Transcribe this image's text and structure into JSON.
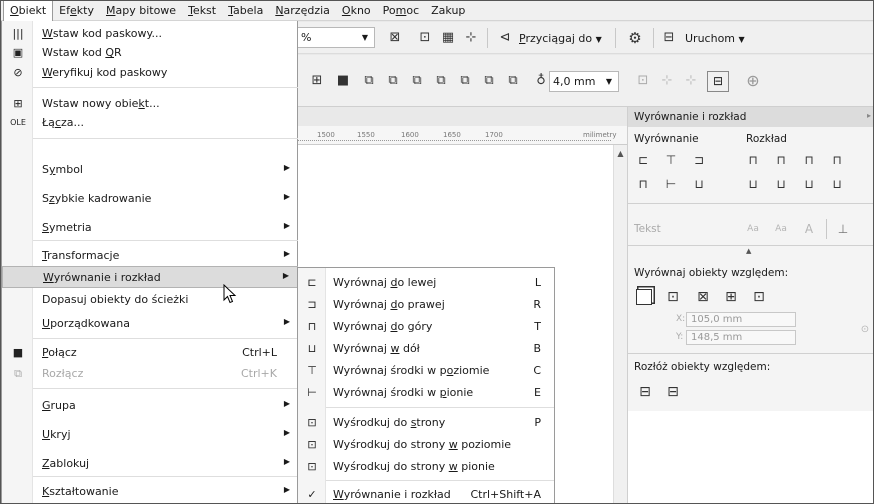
{
  "menubar": {
    "items": [
      {
        "pre": "",
        "u": "O",
        "post": "biekt"
      },
      {
        "pre": "Ef",
        "u": "e",
        "post": "kty"
      },
      {
        "pre": "",
        "u": "M",
        "post": "apy bitowe"
      },
      {
        "pre": "",
        "u": "T",
        "post": "ekst"
      },
      {
        "pre": "",
        "u": "T",
        "post": "abela"
      },
      {
        "pre": "",
        "u": "N",
        "post": "arzędzia"
      },
      {
        "pre": "",
        "u": "O",
        "post": "kno"
      },
      {
        "pre": "Po",
        "u": "m",
        "post": "oc"
      },
      {
        "pre": "Zakup",
        "u": "",
        "post": ""
      }
    ]
  },
  "toolbar": {
    "zoom_value": "%",
    "snap_pre": "",
    "snap_u": "P",
    "snap_post": "rzyciągaj do",
    "launch_label": "Uruchom",
    "outline_value": "4,0 mm"
  },
  "ruler": {
    "ticks": [
      "1500",
      "1550",
      "1600",
      "1650",
      "1700"
    ],
    "unit": "milimetry"
  },
  "docker": {
    "title": "Wyrównanie i rozkład",
    "align_tab": "Wyrównanie",
    "distribute_tab": "Rozkład",
    "text_label": "Tekst",
    "align_relative_label": "Wyrównaj obiekty względem:",
    "x_value": "105,0 mm",
    "y_value": "148,5 mm",
    "x_label": "X:",
    "y_label": "Y:",
    "distribute_relative_label": "Rozłóż obiekty względem:"
  },
  "menu": {
    "items": [
      {
        "icon": "barcode-icon",
        "pre": "",
        "u": "W",
        "post": "staw kod paskowy...",
        "shortcut": "",
        "arrow": false,
        "disabled": false
      },
      {
        "icon": "qr-code-icon",
        "pre": "Wstaw kod ",
        "u": "Q",
        "post": "R",
        "shortcut": "",
        "arrow": false,
        "disabled": false
      },
      {
        "icon": "verify-barcode-icon",
        "pre": "",
        "u": "W",
        "post": "eryfikuj kod paskowy",
        "shortcut": "",
        "arrow": false,
        "disabled": false
      },
      {
        "icon": "insert-object-icon",
        "pre": "Wstaw nowy obie",
        "u": "k",
        "post": "t...",
        "shortcut": "",
        "arrow": false,
        "disabled": false
      },
      {
        "icon": "ole-links-icon",
        "pre": "Łą",
        "u": "c",
        "post": "za...",
        "shortcut": "",
        "arrow": false,
        "disabled": false
      },
      {
        "icon": "",
        "pre": "S",
        "u": "y",
        "post": "mbol",
        "shortcut": "",
        "arrow": true,
        "disabled": false
      },
      {
        "icon": "",
        "pre": "S",
        "u": "z",
        "post": "ybkie kadrowanie",
        "shortcut": "",
        "arrow": true,
        "disabled": false
      },
      {
        "icon": "",
        "pre": "",
        "u": "S",
        "post": "ymetria",
        "shortcut": "",
        "arrow": true,
        "disabled": false
      },
      {
        "icon": "",
        "pre": "",
        "u": "T",
        "post": "ransformacje",
        "shortcut": "",
        "arrow": true,
        "disabled": false
      },
      {
        "icon": "",
        "pre": "",
        "u": "W",
        "post": "yrównanie i rozkład",
        "shortcut": "",
        "arrow": true,
        "disabled": false
      },
      {
        "icon": "",
        "pre": "Dopasuj obiekty do ścieżki",
        "u": "",
        "post": "",
        "shortcut": "",
        "arrow": false,
        "disabled": false
      },
      {
        "icon": "",
        "pre": "",
        "u": "U",
        "post": "porządkowana",
        "shortcut": "",
        "arrow": true,
        "disabled": false
      },
      {
        "icon": "combine-icon",
        "pre": "",
        "u": "P",
        "post": "ołącz",
        "shortcut": "Ctrl+L",
        "arrow": false,
        "disabled": false
      },
      {
        "icon": "break-apart-icon",
        "pre": "Rozłącz",
        "u": "",
        "post": "",
        "shortcut": "Ctrl+K",
        "arrow": false,
        "disabled": true
      },
      {
        "icon": "",
        "pre": "",
        "u": "G",
        "post": "rupa",
        "shortcut": "",
        "arrow": true,
        "disabled": false
      },
      {
        "icon": "",
        "pre": "",
        "u": "U",
        "post": "kryj",
        "shortcut": "",
        "arrow": true,
        "disabled": false
      },
      {
        "icon": "",
        "pre": "",
        "u": "Z",
        "post": "ablokuj",
        "shortcut": "",
        "arrow": true,
        "disabled": false
      },
      {
        "icon": "",
        "pre": "",
        "u": "K",
        "post": "ształtowanie",
        "shortcut": "",
        "arrow": true,
        "disabled": false
      }
    ]
  },
  "submenu": {
    "items": [
      {
        "icon": "align-left-icon",
        "pre": "Wyrównaj ",
        "u": "d",
        "post": "o lewej",
        "shortcut": "L"
      },
      {
        "icon": "align-right-icon",
        "pre": "Wyrównaj ",
        "u": "d",
        "post": "o prawej",
        "shortcut": "R"
      },
      {
        "icon": "align-top-icon",
        "pre": "Wyrównaj ",
        "u": "d",
        "post": "o góry",
        "shortcut": "T"
      },
      {
        "icon": "align-bottom-icon",
        "pre": "Wyrównaj ",
        "u": "w",
        "post": " dół",
        "shortcut": "B"
      },
      {
        "icon": "align-hcenter-icon",
        "pre": "Wyrównaj środki w p",
        "u": "o",
        "post": "ziomie",
        "shortcut": "C"
      },
      {
        "icon": "align-vcenter-icon",
        "pre": "Wyrównaj środki w ",
        "u": "p",
        "post": "ionie",
        "shortcut": "E"
      },
      {
        "icon": "center-page-icon",
        "pre": "Wyśrodkuj do ",
        "u": "s",
        "post": "trony",
        "shortcut": "P"
      },
      {
        "icon": "center-page-h-icon",
        "pre": "Wyśrodkuj do strony ",
        "u": "w",
        "post": " poziomie",
        "shortcut": ""
      },
      {
        "icon": "center-page-v-icon",
        "pre": "Wyśrodkuj do strony ",
        "u": "w",
        "post": " pionie",
        "shortcut": ""
      },
      {
        "icon": "checkmark-icon",
        "pre": "",
        "u": "W",
        "post": "yrównanie i rozkład",
        "shortcut": "Ctrl+Shift+A"
      }
    ]
  }
}
